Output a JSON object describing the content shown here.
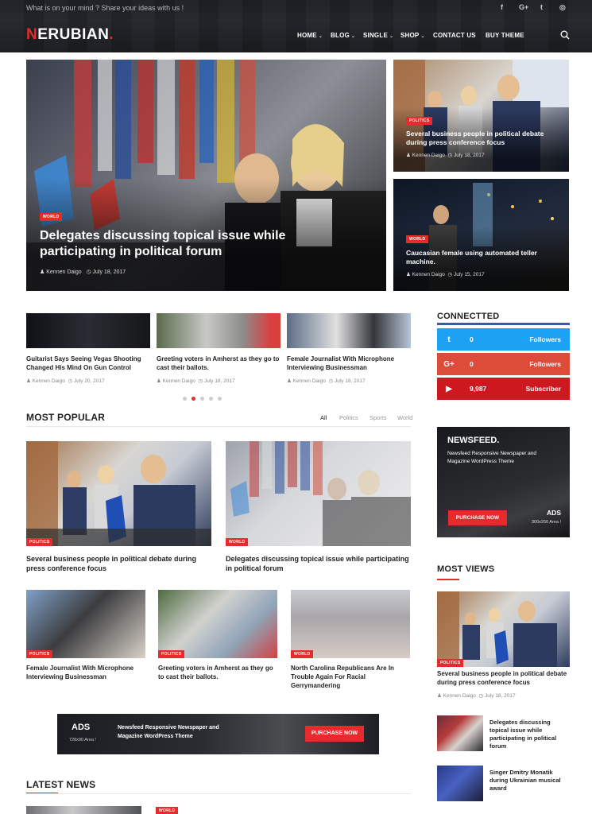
{
  "header": {
    "tagline": "What is on your mind ? Share your ideas with us !",
    "social_icons": [
      "facebook-icon",
      "google-plus-icon",
      "twitter-icon",
      "instagram-icon"
    ],
    "social_glyphs": [
      "f",
      "G+",
      "t",
      "◎"
    ],
    "logo_first": "N",
    "logo_rest": "ERUBIAN",
    "logo_dot": ".",
    "nav": [
      {
        "label": "HOME",
        "dropdown": true
      },
      {
        "label": "BLOG",
        "dropdown": true
      },
      {
        "label": "SINGLE",
        "dropdown": true
      },
      {
        "label": "SHOP",
        "dropdown": true
      },
      {
        "label": "CONTACT US",
        "dropdown": false
      },
      {
        "label": "BUY THEME",
        "dropdown": false
      }
    ]
  },
  "hero": {
    "main": {
      "category": "WORLD",
      "title": "Delegates discussing topical issue while participating in political forum",
      "author": "Kennen Daigo",
      "date": "July 18, 2017"
    },
    "side": [
      {
        "category": "POLITICS",
        "title": "Several business people in political debate during press conference focus",
        "author": "Kennen Daigo",
        "date": "July 18, 2017"
      },
      {
        "category": "WORLD",
        "title": "Caucasian female using automated teller machine.",
        "author": "Kennen Daigo",
        "date": "July 15, 2017"
      }
    ]
  },
  "carousel": {
    "items": [
      {
        "title": "Guitarist Says Seeing Vegas Shooting Changed His Mind On Gun Control",
        "author": "Kennen Daigo",
        "date": "July 20, 2017"
      },
      {
        "title": "Greeting voters in Amherst as they go to cast their ballots.",
        "author": "Kennen Daigo",
        "date": "July 18, 2017"
      },
      {
        "title": "Female Journalist With Microphone Interviewing Businessman",
        "author": "Kennen Daigo",
        "date": "July 18, 2017"
      }
    ],
    "dots": 5,
    "active_dot": 1
  },
  "most_popular": {
    "title": "MOST POPULAR",
    "filters": [
      "All",
      "Politics",
      "Sports",
      "World"
    ],
    "active_filter": "All",
    "big": [
      {
        "category": "POLITICS",
        "title": "Several business people in political debate during press conference focus"
      },
      {
        "category": "WORLD",
        "title": "Delegates discussing topical issue while participating in political forum"
      }
    ],
    "small": [
      {
        "category": "POLITICS",
        "title": "Female Journalist With Microphone Interviewing Businessman"
      },
      {
        "category": "POLITICS",
        "title": "Greeting voters in Amherst as they go to cast their ballots."
      },
      {
        "category": "WORLD",
        "title": "North Carolina Republicans Are In Trouble Again For Racial Gerrymandering"
      }
    ]
  },
  "banner_ad": {
    "ads_label": "ADS",
    "size": "728x90 Area !",
    "text": "Newsfeed Responsive Newspaper and Magazine WordPress Theme",
    "button": "PURCHASE NOW"
  },
  "latest_news": {
    "title": "LATEST NEWS",
    "category": "WORLD"
  },
  "sidebar": {
    "connected_title": "CONNECTTED",
    "social": [
      {
        "icon": "twitter-icon",
        "glyph": "t",
        "count": "0",
        "label": "Followers",
        "color": "#1da1f2"
      },
      {
        "icon": "google-plus-icon",
        "glyph": "G+",
        "count": "0",
        "label": "Followers",
        "color": "#dd4b39"
      },
      {
        "icon": "youtube-icon",
        "glyph": "▶",
        "count": "9,987",
        "label": "Subscriber",
        "color": "#cc181e"
      }
    ],
    "ad": {
      "brand": "NEWSFEED.",
      "text": "Newsfeed Responsive Newspaper and Magazine WordPress Theme",
      "button": "PURCHASE NOW",
      "ads_label": "ADS",
      "size": "300x250 Area !"
    },
    "most_views_title": "MOST VIEWS",
    "most_views_main": {
      "category": "POLITICS",
      "title": "Several business people in political debate during press conference focus",
      "author": "Kennen Daigo",
      "date": "July 18, 2017"
    },
    "most_views_list": [
      {
        "title": "Delegates discussing topical issue while participating in political forum"
      },
      {
        "title": "Singer Dmitry Monatik during Ukrainian musical award"
      }
    ]
  },
  "colors": {
    "accent": "#e52b2b",
    "dark": "#1d1f24"
  }
}
